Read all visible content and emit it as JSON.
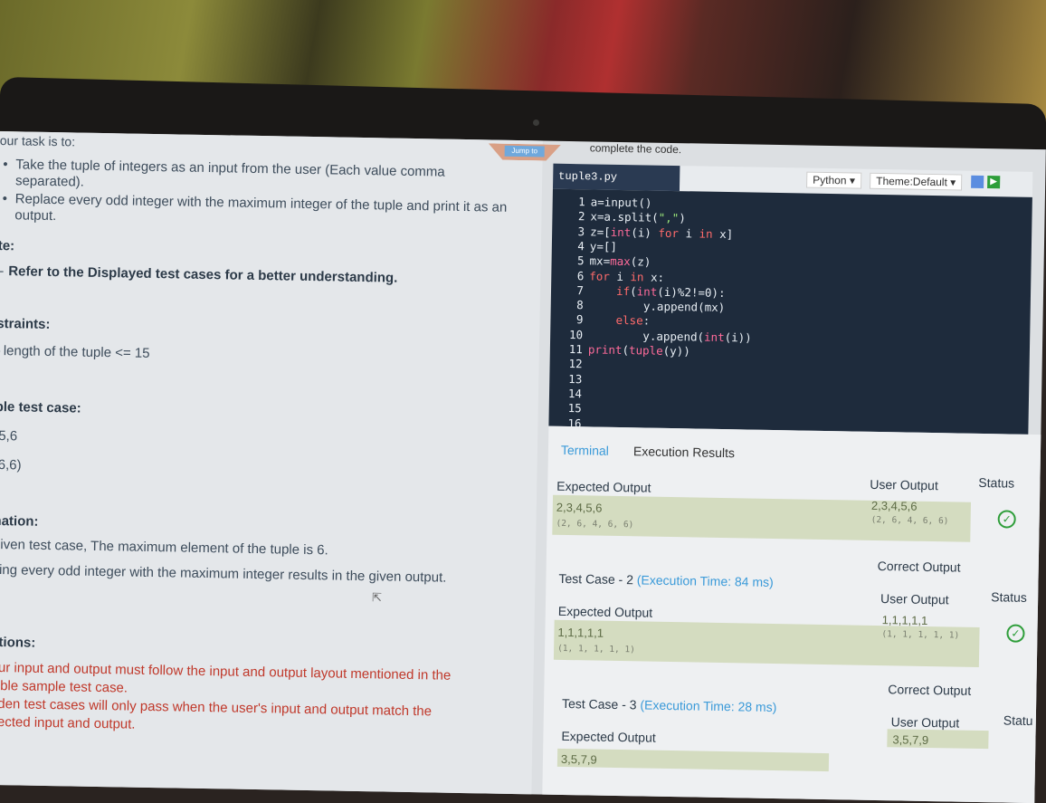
{
  "left": {
    "task_intro": "our task is to:",
    "bullet1": "Take the tuple of integers as an input from the user (Each value comma",
    "bullet1_cont": "separated).",
    "bullet2": "Replace every odd integer with the maximum integer of the tuple and print it as an",
    "bullet2_cont": "output.",
    "note_heading": "te:",
    "note_text": "Refer to the Displayed test cases for a better understanding.",
    "constraints_heading": "straints:",
    "constraint": "length of the tuple <= 15",
    "sample_heading": "ple test case:",
    "sample_input": ",5,6",
    "sample_output": ",6,6)",
    "explanation_heading": "nation:",
    "explanation1": "given test case, The maximum element of the tuple is 6.",
    "explanation2": "cing every odd integer with the maximum integer results in the given output.",
    "instructions_heading": "ctions:",
    "instr1": "our input and output must follow the input and output layout mentioned in the",
    "instr2": "sible sample test case.",
    "instr3": "dden test cases will only pass when the user's input and output match the",
    "instr4": "pected input and output."
  },
  "editor": {
    "jump_label": "Jump to",
    "header_text": "complete the code.",
    "file_tab": "tuple3.py",
    "language": "Python",
    "theme": "Theme:Default",
    "lines": [
      {
        "n": "1",
        "code": "a=input()"
      },
      {
        "n": "2",
        "code": "x=a.split(\",\")"
      },
      {
        "n": "3",
        "code": "z=[int(i) for i in x]"
      },
      {
        "n": "4",
        "code": "y=[]"
      },
      {
        "n": "5",
        "code": "mx=max(z)"
      },
      {
        "n": "6",
        "code": "for i in x:"
      },
      {
        "n": "7",
        "code": "    if(int(i)%2!=0):"
      },
      {
        "n": "8",
        "code": "        y.append(mx)"
      },
      {
        "n": "9",
        "code": "    else:"
      },
      {
        "n": "10",
        "code": "        y.append(int(i))"
      },
      {
        "n": "11",
        "code": "print(tuple(y))"
      },
      {
        "n": "12",
        "code": ""
      },
      {
        "n": "13",
        "code": ""
      },
      {
        "n": "14",
        "code": ""
      },
      {
        "n": "15",
        "code": ""
      },
      {
        "n": "16",
        "code": ""
      }
    ]
  },
  "results": {
    "tab_terminal": "Terminal",
    "tab_exec": "Execution Results",
    "case1": {
      "expected_label": "Expected Output",
      "user_label": "User Output",
      "status_label": "Status",
      "expected_val": "2,3,4,5,6",
      "expected_tuple": "(2, 6, 4, 6, 6)",
      "user_val": "2,3,4,5,6",
      "user_tuple": "(2, 6, 4, 6, 6)"
    },
    "case2": {
      "title": "Test Case - 2",
      "time": "(Execution Time: 84 ms)",
      "correct": "Correct Output",
      "expected_label": "Expected Output",
      "user_label": "User Output",
      "status_label": "Status",
      "expected_val": "1,1,1,1,1",
      "expected_tuple": "(1, 1, 1, 1, 1)",
      "user_val": "1,1,1,1,1",
      "user_tuple": "(1, 1, 1, 1, 1)"
    },
    "case3": {
      "title": "Test Case - 3",
      "time": "(Execution Time: 28 ms)",
      "correct": "Correct Output",
      "expected_label": "Expected Output",
      "user_label": "User Output",
      "status_label": "Statu",
      "expected_val": "3,5,7,9",
      "user_val": "3,5,7,9"
    }
  }
}
